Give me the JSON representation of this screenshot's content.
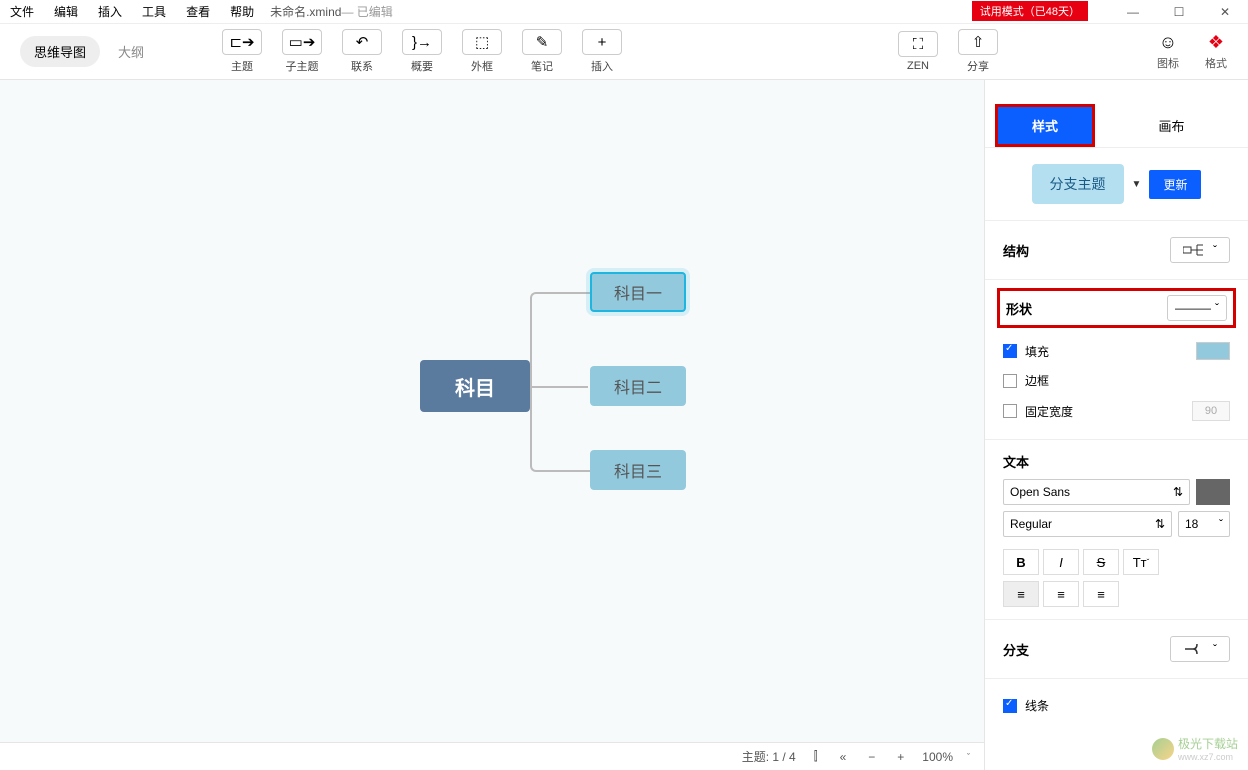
{
  "menu": {
    "file": "文件",
    "edit": "编辑",
    "insert": "插入",
    "tools": "工具",
    "view": "查看",
    "help": "帮助"
  },
  "title": {
    "filename": "未命名.xmind",
    "edited": " — 已编辑"
  },
  "trial": "试用模式（已48天）",
  "view_toggle": {
    "mindmap": "思维导图",
    "outline": "大纲"
  },
  "toolbar": {
    "topic": "主题",
    "subtopic": "子主题",
    "relationship": "联系",
    "summary": "概要",
    "boundary": "外框",
    "note": "笔记",
    "insert": "插入",
    "zen": "ZEN",
    "share": "分享"
  },
  "top_right": {
    "icon": "图标",
    "format": "格式"
  },
  "mindmap": {
    "root": "科目",
    "sub1": "科目一",
    "sub2": "科目二",
    "sub3": "科目三"
  },
  "panel": {
    "tab_style": "样式",
    "tab_canvas": "画布",
    "topic_type": "分支主题",
    "update": "更新",
    "structure": "结构",
    "shape": "形状",
    "fill": "填充",
    "border": "边框",
    "fixed_width": "固定宽度",
    "fixed_width_val": "90",
    "text": "文本",
    "font": "Open Sans",
    "weight": "Regular",
    "size": "18",
    "branch": "分支",
    "line": "线条"
  },
  "status": {
    "topics": "主题: 1 / 4",
    "zoom": "100%"
  },
  "watermark": {
    "name": "极光下载站",
    "url": "www.xz7.com"
  },
  "glyphs": {
    "topic": "⊏➔",
    "subtopic": "▭➔",
    "rel": "↶",
    "summary": "}→",
    "boundary": "⬚",
    "note": "✎",
    "insert": "+",
    "zen": "⛶",
    "share": "⇧",
    "emoji": "☺",
    "brush": "❖",
    "caret": "▼",
    "chev": "ˇ",
    "updown": "⇅",
    "bold": "B",
    "italic": "I",
    "strike": "S",
    "tt": "Tᴛ",
    "align_l": "≡",
    "align_c": "≡",
    "align_r": "≡",
    "map": "⫿",
    "collapse": "«",
    "minus": "−",
    "plus": "+",
    "min": "—",
    "max": "☐",
    "close": "✕",
    "line_glyph": "———"
  }
}
